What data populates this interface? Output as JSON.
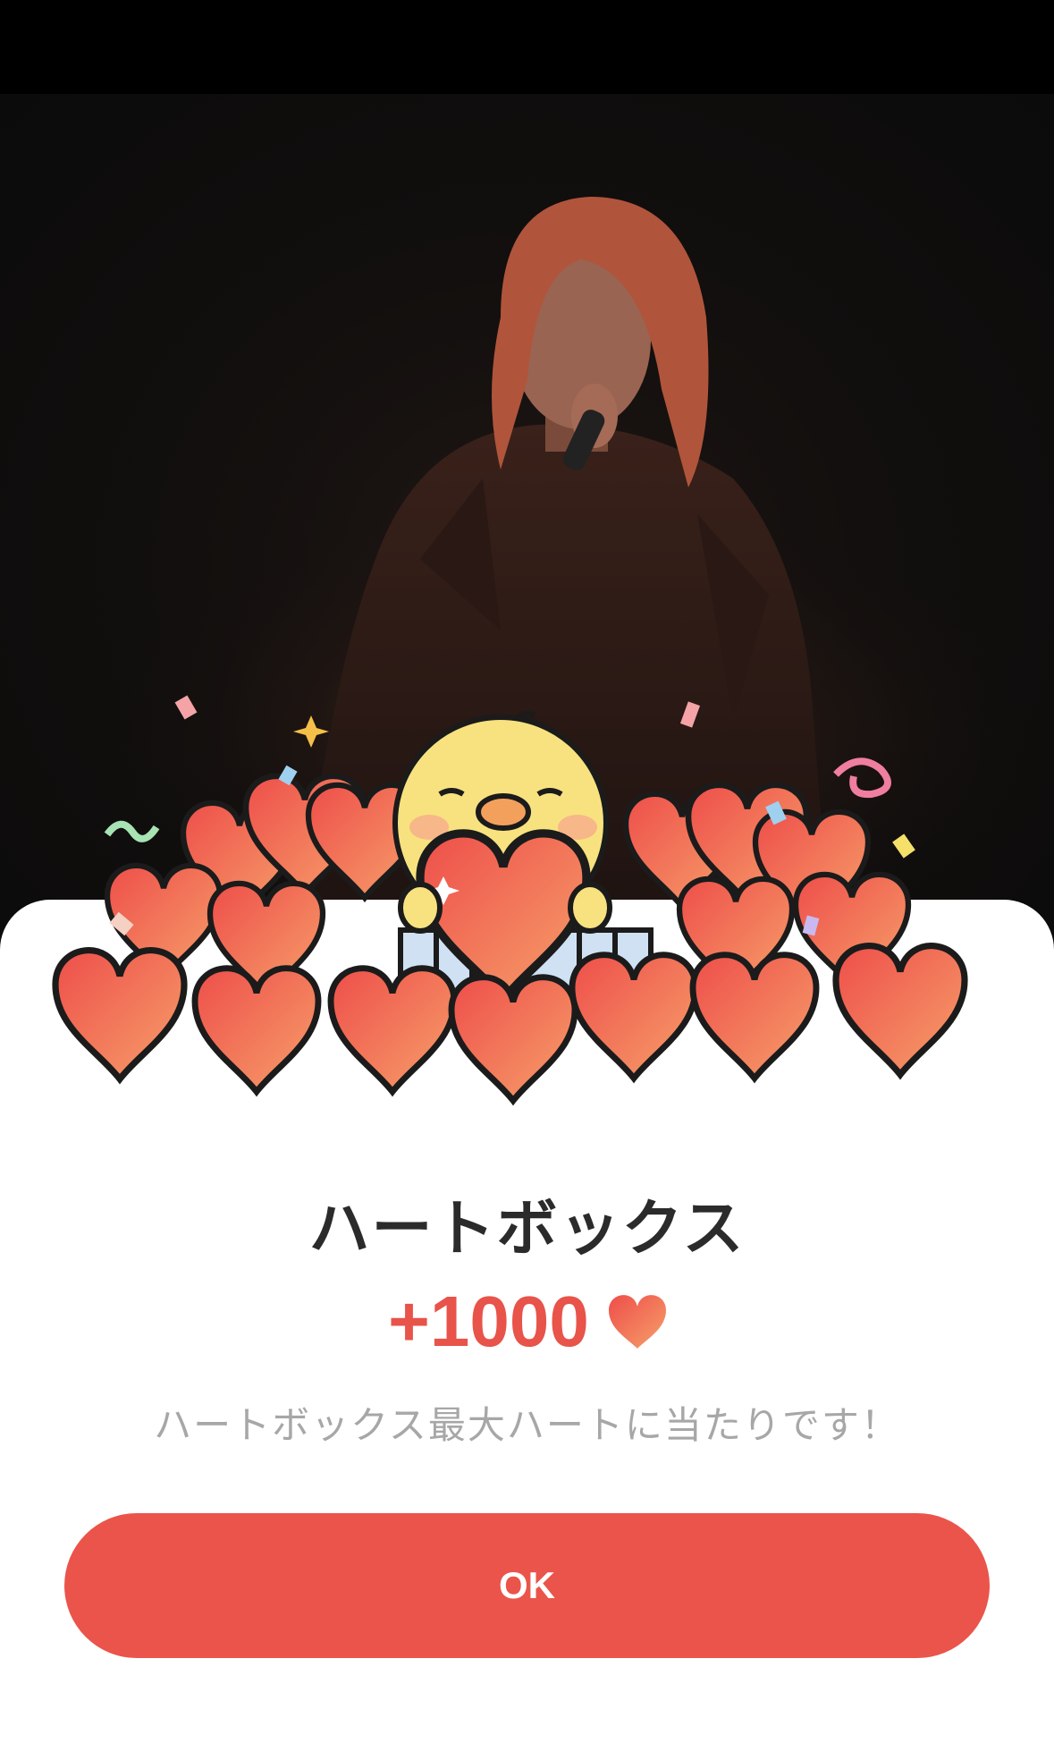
{
  "dialog": {
    "title": "ハートボックス",
    "reward_amount": "+1000",
    "reward_icon": "heart-icon",
    "message": "ハートボックス最大ハートに当たりです！",
    "ok_label": "OK"
  },
  "colors": {
    "accent": "#ea544a",
    "reward_text": "#e8534a",
    "title_text": "#2b2b2b",
    "message_text": "#a7a7a7",
    "background": "#0e0e0e"
  }
}
